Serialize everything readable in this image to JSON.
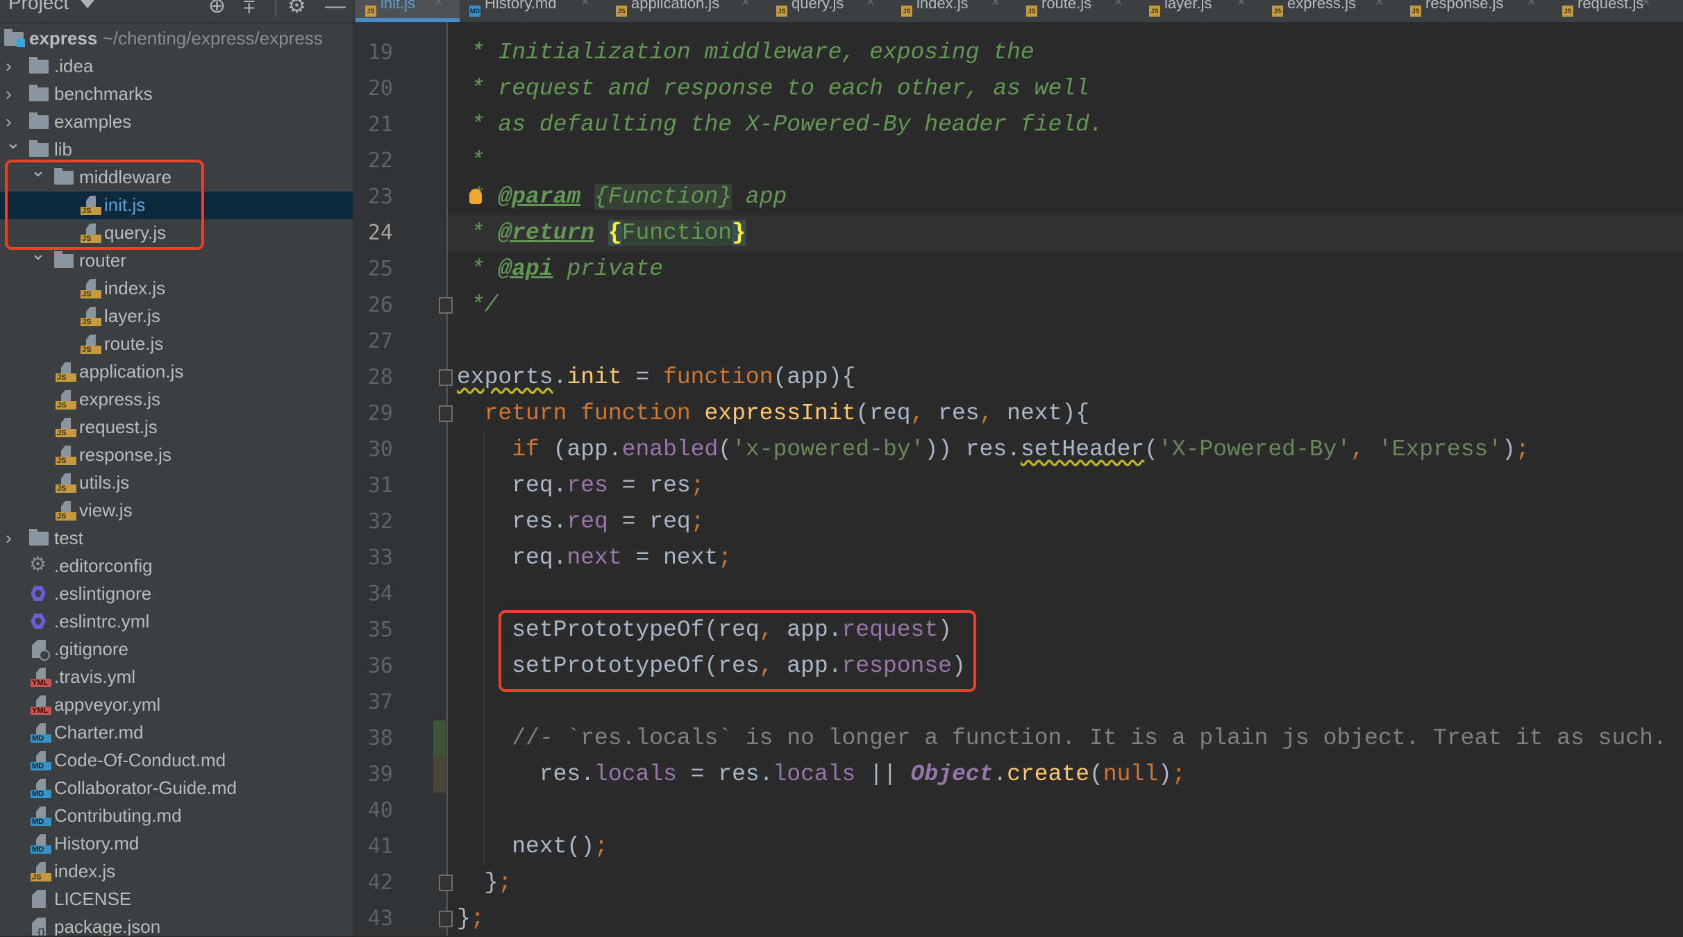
{
  "sidebar": {
    "title": "Project",
    "header_icons": [
      "locate-icon",
      "collapse-all-icon",
      "gear-icon",
      "minimize-icon"
    ],
    "root": {
      "name": "express",
      "path": "~/chenting/express/express"
    },
    "items": [
      {
        "label": ".idea",
        "type": "folder",
        "depth": 0,
        "expanded": false
      },
      {
        "label": "benchmarks",
        "type": "folder",
        "depth": 0,
        "expanded": false
      },
      {
        "label": "examples",
        "type": "folder",
        "depth": 0,
        "expanded": false
      },
      {
        "label": "lib",
        "type": "folder",
        "depth": 0,
        "expanded": true
      },
      {
        "label": "middleware",
        "type": "folder",
        "depth": 1,
        "expanded": true
      },
      {
        "label": "init.js",
        "type": "js",
        "depth": 2,
        "selected": true
      },
      {
        "label": "query.js",
        "type": "js",
        "depth": 2
      },
      {
        "label": "router",
        "type": "folder",
        "depth": 1,
        "expanded": true
      },
      {
        "label": "index.js",
        "type": "js",
        "depth": 2
      },
      {
        "label": "layer.js",
        "type": "js",
        "depth": 2
      },
      {
        "label": "route.js",
        "type": "js",
        "depth": 2
      },
      {
        "label": "application.js",
        "type": "js",
        "depth": 1
      },
      {
        "label": "express.js",
        "type": "js",
        "depth": 1
      },
      {
        "label": "request.js",
        "type": "js",
        "depth": 1
      },
      {
        "label": "response.js",
        "type": "js",
        "depth": 1
      },
      {
        "label": "utils.js",
        "type": "js",
        "depth": 1
      },
      {
        "label": "view.js",
        "type": "js",
        "depth": 1
      },
      {
        "label": "test",
        "type": "folder",
        "depth": 0,
        "expanded": false
      },
      {
        "label": ".editorconfig",
        "type": "config",
        "depth": 0
      },
      {
        "label": ".eslintignore",
        "type": "eslint",
        "depth": 0
      },
      {
        "label": ".eslintrc.yml",
        "type": "eslint",
        "depth": 0
      },
      {
        "label": ".gitignore",
        "type": "ignore",
        "depth": 0
      },
      {
        "label": ".travis.yml",
        "type": "yml",
        "depth": 0
      },
      {
        "label": "appveyor.yml",
        "type": "yml",
        "depth": 0
      },
      {
        "label": "Charter.md",
        "type": "md",
        "depth": 0
      },
      {
        "label": "Code-Of-Conduct.md",
        "type": "md",
        "depth": 0
      },
      {
        "label": "Collaborator-Guide.md",
        "type": "md",
        "depth": 0
      },
      {
        "label": "Contributing.md",
        "type": "md",
        "depth": 0
      },
      {
        "label": "History.md",
        "type": "md",
        "depth": 0
      },
      {
        "label": "index.js",
        "type": "js",
        "depth": 0
      },
      {
        "label": "LICENSE",
        "type": "text",
        "depth": 0
      },
      {
        "label": "package.json",
        "type": "json",
        "depth": 0
      }
    ]
  },
  "tabs": [
    {
      "label": "init.js",
      "type": "js",
      "active": true
    },
    {
      "label": "History.md",
      "type": "md"
    },
    {
      "label": "application.js",
      "type": "js"
    },
    {
      "label": "query.js",
      "type": "js"
    },
    {
      "label": "index.js",
      "type": "js"
    },
    {
      "label": "route.js",
      "type": "js"
    },
    {
      "label": "layer.js",
      "type": "js"
    },
    {
      "label": "express.js",
      "type": "js"
    },
    {
      "label": "response.js",
      "type": "js"
    },
    {
      "label": "request.js",
      "type": "js"
    }
  ],
  "tab_close_glyph": "×",
  "file_tags": {
    "js": "JS",
    "md": "MD",
    "yml": "YML"
  },
  "editor": {
    "current_line": 24,
    "lines": [
      {
        "n": "19",
        "tokens": [
          [
            "c-doc",
            " * Initialization middleware, exposing the"
          ]
        ]
      },
      {
        "n": "20",
        "tokens": [
          [
            "c-doc",
            " * request and response to each other, as well"
          ]
        ]
      },
      {
        "n": "21",
        "tokens": [
          [
            "c-doc",
            " * as defaulting the X-Powered-By header field."
          ]
        ]
      },
      {
        "n": "22",
        "tokens": [
          [
            "c-doc",
            " *"
          ]
        ]
      },
      {
        "n": "23",
        "tokens": [
          [
            "c-doc",
            " * "
          ],
          [
            "c-tag",
            "@param"
          ],
          [
            "c-doc",
            " "
          ],
          [
            "c-doc c-typebg",
            "{Function}"
          ],
          [
            "c-doc",
            " app"
          ]
        ]
      },
      {
        "n": "24",
        "tokens": [
          [
            "c-doc",
            " * "
          ],
          [
            "c-tag",
            "@return"
          ],
          [
            "c-doc",
            " "
          ],
          [
            "c-brace",
            "{"
          ],
          [
            "c-type c-typebg",
            "Function"
          ],
          [
            "c-brace",
            "}"
          ]
        ]
      },
      {
        "n": "25",
        "tokens": [
          [
            "c-doc",
            " * "
          ],
          [
            "c-tag",
            "@api"
          ],
          [
            "c-doc",
            " private"
          ]
        ]
      },
      {
        "n": "26",
        "tokens": [
          [
            "c-doc",
            " */"
          ]
        ]
      },
      {
        "n": "27",
        "tokens": []
      },
      {
        "n": "28",
        "tokens": [
          [
            "warn",
            "exports"
          ],
          [
            "",
            "."
          ],
          [
            "c-fn",
            "init"
          ],
          [
            "",
            " = "
          ],
          [
            "c-kw",
            "function"
          ],
          [
            "",
            "(app){"
          ]
        ]
      },
      {
        "n": "29",
        "tokens": [
          [
            "",
            "  "
          ],
          [
            "c-kw",
            "return function "
          ],
          [
            "c-fn",
            "expressInit"
          ],
          [
            "",
            "(req"
          ],
          [
            "c-punct",
            ", "
          ],
          [
            "",
            "res"
          ],
          [
            "c-punct",
            ", "
          ],
          [
            "",
            "next){"
          ]
        ]
      },
      {
        "n": "30",
        "tokens": [
          [
            "",
            "    "
          ],
          [
            "c-kw",
            "if "
          ],
          [
            "",
            "(app."
          ],
          [
            "c-prop",
            "enabled"
          ],
          [
            "",
            "("
          ],
          [
            "c-str",
            "'x-powered-by'"
          ],
          [
            "",
            ")) res."
          ],
          [
            "warn",
            "setHeader"
          ],
          [
            "",
            "("
          ],
          [
            "c-str",
            "'X-Powered-By'"
          ],
          [
            "c-punct",
            ", "
          ],
          [
            "c-str",
            "'Express'"
          ],
          [
            "",
            ")"
          ],
          [
            "c-punct",
            ";"
          ]
        ]
      },
      {
        "n": "31",
        "tokens": [
          [
            "",
            "    req."
          ],
          [
            "c-prop",
            "res"
          ],
          [
            "",
            " = res"
          ],
          [
            "c-punct",
            ";"
          ]
        ]
      },
      {
        "n": "32",
        "tokens": [
          [
            "",
            "    res."
          ],
          [
            "c-prop",
            "req"
          ],
          [
            "",
            " = req"
          ],
          [
            "c-punct",
            ";"
          ]
        ]
      },
      {
        "n": "33",
        "tokens": [
          [
            "",
            "    req."
          ],
          [
            "c-prop",
            "next"
          ],
          [
            "",
            " = next"
          ],
          [
            "c-punct",
            ";"
          ]
        ]
      },
      {
        "n": "34",
        "tokens": []
      },
      {
        "n": "35",
        "tokens": [
          [
            "",
            "    setPrototypeOf(req"
          ],
          [
            "c-punct",
            ", "
          ],
          [
            "",
            "app."
          ],
          [
            "c-prop",
            "request"
          ],
          [
            "",
            ")"
          ]
        ]
      },
      {
        "n": "36",
        "tokens": [
          [
            "",
            "    setPrototypeOf(res"
          ],
          [
            "c-punct",
            ", "
          ],
          [
            "",
            "app."
          ],
          [
            "c-prop",
            "response"
          ],
          [
            "",
            ")"
          ]
        ]
      },
      {
        "n": "37",
        "tokens": []
      },
      {
        "n": "38",
        "tokens": [
          [
            "c-cmt",
            "    //- `res.locals` is no longer a function. It is a plain js object. Treat it as such."
          ]
        ]
      },
      {
        "n": "39",
        "tokens": [
          [
            "",
            "      res."
          ],
          [
            "c-prop",
            "locals"
          ],
          [
            "",
            " = res."
          ],
          [
            "c-prop",
            "locals"
          ],
          [
            "",
            " || "
          ],
          [
            "c-obj",
            "Object"
          ],
          [
            "",
            "."
          ],
          [
            "c-fn",
            "create"
          ],
          [
            "",
            "("
          ],
          [
            "c-null",
            "null"
          ],
          [
            "",
            ")"
          ],
          [
            "c-punct",
            ";"
          ]
        ]
      },
      {
        "n": "40",
        "tokens": []
      },
      {
        "n": "41",
        "tokens": [
          [
            "",
            "    next()"
          ],
          [
            "c-punct",
            ";"
          ]
        ]
      },
      {
        "n": "42",
        "tokens": [
          [
            "",
            "  }"
          ],
          [
            "c-punct",
            ";"
          ]
        ]
      },
      {
        "n": "43",
        "tokens": [
          [
            "",
            "}"
          ],
          [
            "c-punct",
            ";"
          ]
        ]
      }
    ]
  },
  "annotations": {
    "color": "#e8412c",
    "boxes": [
      "middleware-folder-group",
      "setPrototypeOf-lines"
    ]
  }
}
